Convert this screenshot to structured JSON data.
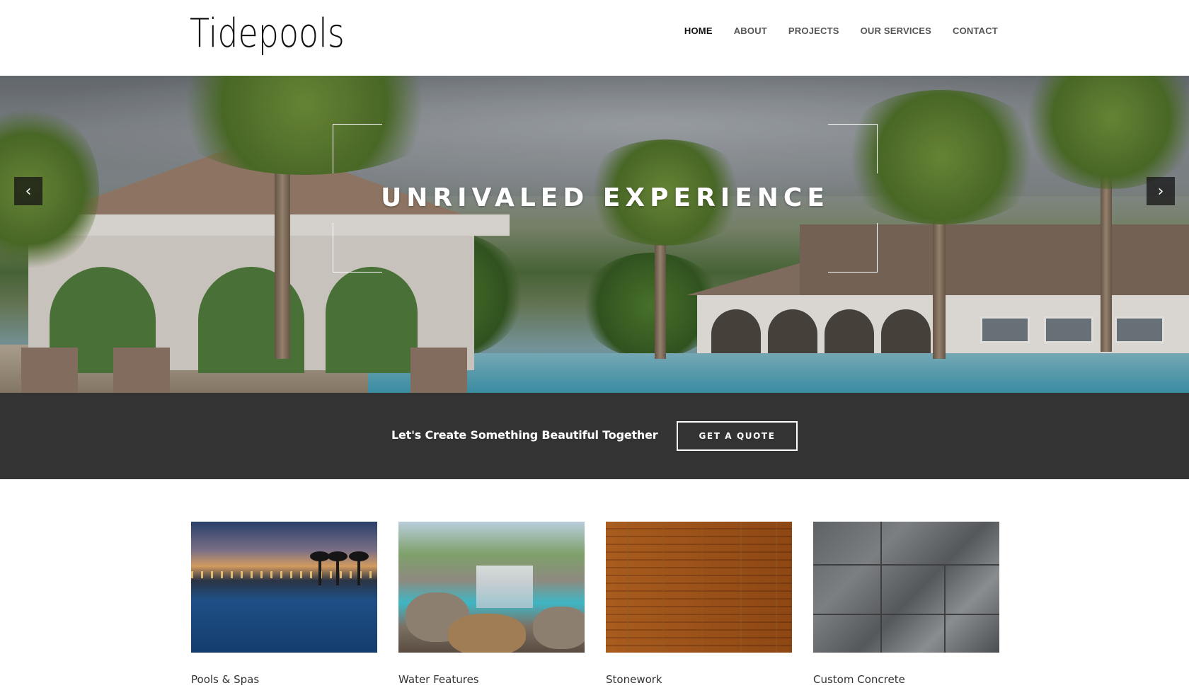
{
  "brand": {
    "logo": "Tidepools"
  },
  "nav": {
    "items": [
      {
        "label": "HOME",
        "active": true
      },
      {
        "label": "ABOUT",
        "active": false
      },
      {
        "label": "PROJECTS",
        "active": false
      },
      {
        "label": "OUR SERVICES",
        "active": false
      },
      {
        "label": "CONTACT",
        "active": false
      }
    ]
  },
  "hero": {
    "title": "UNRIVALED EXPERIENCE",
    "prev_icon": "chevron-left-icon",
    "next_icon": "chevron-right-icon",
    "prev_glyph": "‹",
    "next_glyph": "›"
  },
  "cta": {
    "text": "Let's Create Something Beautiful Together",
    "button_label": "GET A QUOTE"
  },
  "services": {
    "items": [
      {
        "label": "Pools & Spas"
      },
      {
        "label": "Water Features"
      },
      {
        "label": "Stonework"
      },
      {
        "label": "Custom Concrete"
      }
    ]
  },
  "colors": {
    "cta_background": "#333333",
    "header_background": "#ffffff",
    "nav_text": "#555555",
    "nav_active_text": "#111111"
  }
}
